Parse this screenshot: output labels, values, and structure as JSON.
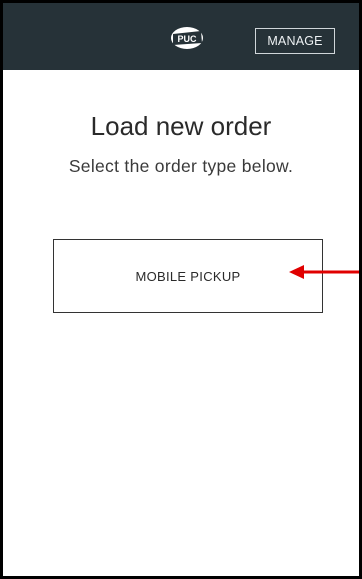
{
  "header": {
    "logo_text": "PUC",
    "manage_label": "MANAGE",
    "background": "#263238"
  },
  "main": {
    "title": "Load new order",
    "subtitle": "Select the order type below.",
    "order_types": [
      {
        "label": "MOBILE PICKUP"
      }
    ]
  },
  "annotation": {
    "icon": "arrow-left-icon",
    "color": "#e00000"
  }
}
